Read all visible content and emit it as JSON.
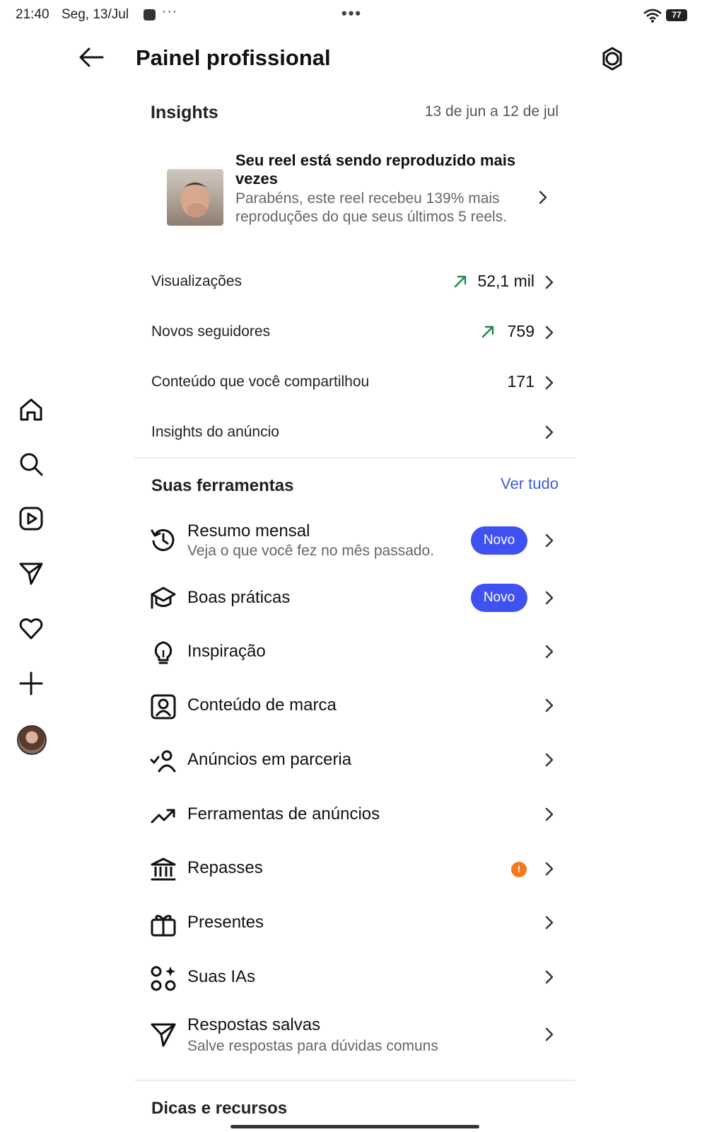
{
  "status_bar": {
    "time": "21:40",
    "date": "Seg, 13/Jul",
    "more": "···",
    "center": "•••",
    "battery": "77"
  },
  "header": {
    "title": "Painel profissional",
    "back_icon": "arrow-left-icon",
    "settings_icon": "gear-icon"
  },
  "left_rail": {
    "icons": [
      "home-icon",
      "search-icon",
      "reels-icon",
      "send-icon",
      "heart-icon",
      "plus-icon",
      "avatar"
    ]
  },
  "insights": {
    "title": "Insights",
    "date_range": "13 de jun a 12 de jul",
    "reel_card": {
      "title": "Seu reel está sendo reproduzido mais vezes",
      "description": "Parabéns, este reel recebeu 139% mais reproduções do que seus últimos 5 reels."
    },
    "metrics": [
      {
        "label": "Visualizações",
        "value": "52,1 mil",
        "trend": "up"
      },
      {
        "label": "Novos seguidores",
        "value": "759",
        "trend": "up"
      },
      {
        "label": "Conteúdo que você compartilhou",
        "value": "171",
        "trend": ""
      },
      {
        "label": "Insights do anúncio",
        "value": "",
        "trend": ""
      }
    ]
  },
  "tools": {
    "title": "Suas ferramentas",
    "see_all": "Ver tudo",
    "badge_new": "Novo",
    "alert_symbol": "!",
    "items": [
      {
        "label": "Resumo mensal",
        "subtitle": "Veja o que você fez no mês passado.",
        "icon": "history-icon",
        "badge": "Novo"
      },
      {
        "label": "Boas práticas",
        "subtitle": "",
        "icon": "graduation-cap-icon",
        "badge": "Novo"
      },
      {
        "label": "Inspiração",
        "subtitle": "",
        "icon": "lightbulb-icon",
        "badge": ""
      },
      {
        "label": "Conteúdo de marca",
        "subtitle": "",
        "icon": "branded-content-icon",
        "badge": ""
      },
      {
        "label": "Anúncios em parceria",
        "subtitle": "",
        "icon": "partner-person-icon",
        "badge": ""
      },
      {
        "label": "Ferramentas de anúncios",
        "subtitle": "",
        "icon": "trending-up-icon",
        "badge": ""
      },
      {
        "label": "Repasses",
        "subtitle": "",
        "icon": "bank-icon",
        "badge": "alert"
      },
      {
        "label": "Presentes",
        "subtitle": "",
        "icon": "gift-icon",
        "badge": ""
      },
      {
        "label": "Suas IAs",
        "subtitle": "",
        "icon": "ai-shapes-icon",
        "badge": ""
      },
      {
        "label": "Respostas salvas",
        "subtitle": "Salve respostas para dúvidas comuns",
        "icon": "send-icon",
        "badge": ""
      }
    ]
  },
  "tips": {
    "title": "Dicas e recursos"
  },
  "colors": {
    "accent_blue": "#3f51f0",
    "link_blue": "#3c5fd6",
    "trend_green": "#1a8a4a",
    "alert_orange": "#f47a1c"
  }
}
